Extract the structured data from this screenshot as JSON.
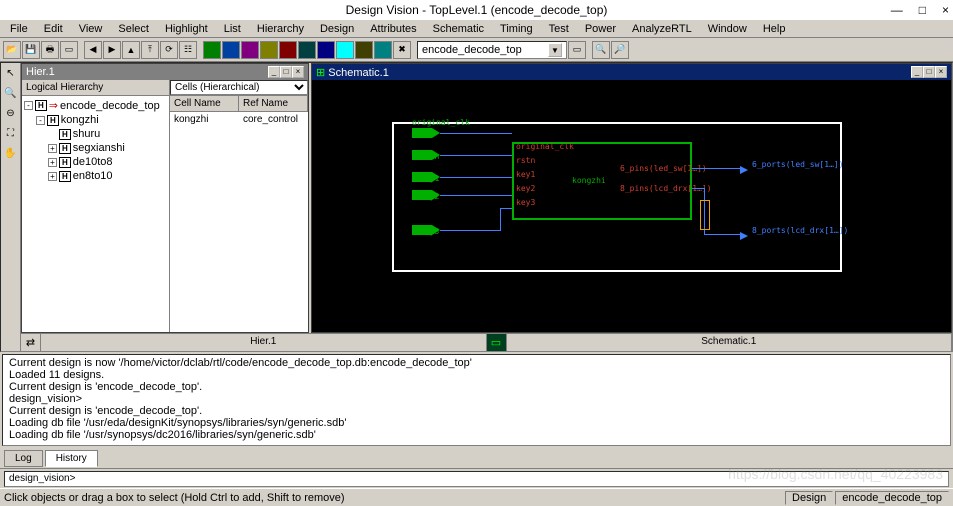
{
  "window": {
    "title": "Design Vision - TopLevel.1 (encode_decode_top)",
    "minimize": "—",
    "maximize": "□",
    "close": "×"
  },
  "menu": [
    "File",
    "Edit",
    "View",
    "Select",
    "Highlight",
    "List",
    "Hierarchy",
    "Design",
    "Attributes",
    "Schematic",
    "Timing",
    "Test",
    "Power",
    "AnalyzeRTL",
    "Window",
    "Help"
  ],
  "toolbar": {
    "combo_value": "encode_decode_top"
  },
  "hier": {
    "panel_title": "Hier.1",
    "tree_header": "Logical Hierarchy",
    "cells_mode": "Cells (Hierarchical)",
    "col1": "Cell Name",
    "col2": "Ref Name",
    "rows": [
      {
        "cell": "kongzhi",
        "ref": "core_control"
      }
    ],
    "tree": {
      "root": "encode_decode_top",
      "child1": "kongzhi",
      "g1": "shuru",
      "g2": "segxianshi",
      "g3": "de10to8",
      "g4": "en8to10"
    }
  },
  "schematic": {
    "panel_title": "Schematic.1",
    "inst": "kongzhi",
    "ports_in": [
      "original_clk",
      "rstn",
      "key1",
      "key2",
      "key3"
    ],
    "pins_in": [
      "original_clk",
      "rstn",
      "key1",
      "key2",
      "key3"
    ],
    "pins_out1": "6_pins(led_sw[1…])",
    "pins_out2": "8_pins(lcd_drx[1…])",
    "port_out1": "6_ports(led_sw[1…])",
    "port_out2": "8_ports(lcd_drx[1…])"
  },
  "tabs": {
    "hier": "Hier.1",
    "schem": "Schematic.1"
  },
  "console": {
    "lines": [
      "Current design is now '/home/victor/dclab/rtl/code/encode_decode_top.db:encode_decode_top'",
      "Loaded 11 designs.",
      "Current design is 'encode_decode_top'.",
      "design_vision>",
      "Current design is 'encode_decode_top'.",
      "Loading db file '/usr/eda/designKit/synopsys/libraries/syn/generic.sdb'",
      "Loading db file '/usr/synopsys/dc2016/libraries/syn/generic.sdb'"
    ],
    "tab_log": "Log",
    "tab_history": "History",
    "prompt": "design_vision>"
  },
  "status": {
    "left": "Click objects or drag a box to select (Hold Ctrl to add, Shift to remove)",
    "right1": "Design",
    "right2": "encode_decode_top"
  },
  "watermark": "https://blog.csdn.net/qq_40223983"
}
